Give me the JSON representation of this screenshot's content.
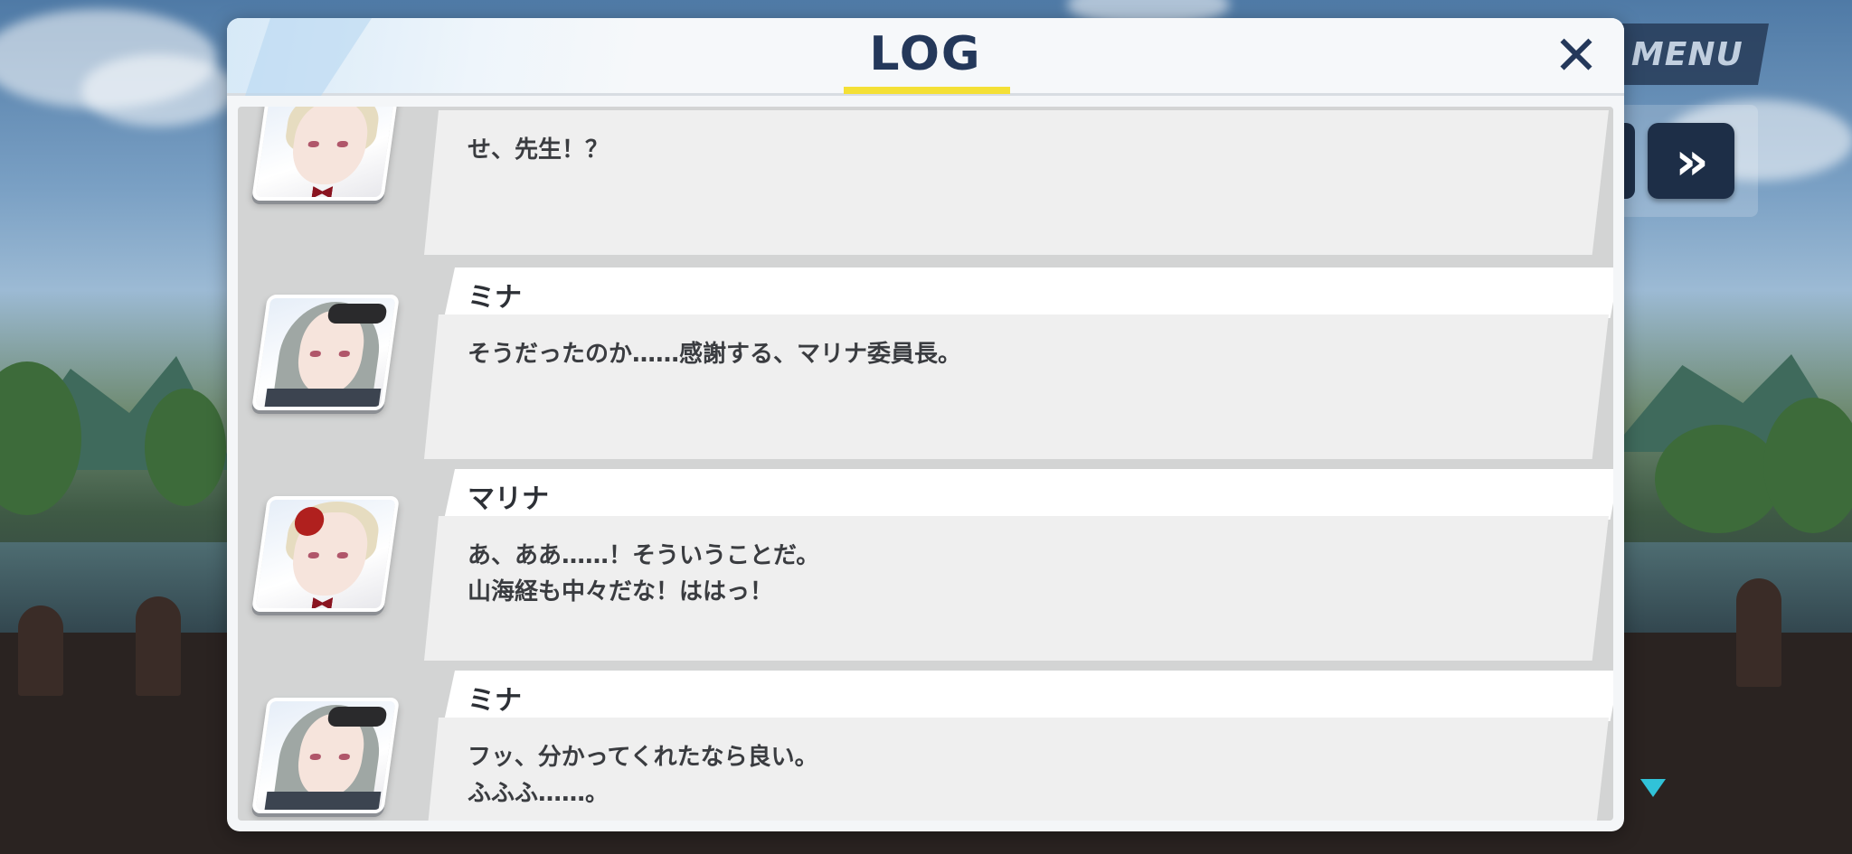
{
  "menu": {
    "label": "MENU",
    "fast_forward_icon": "fast-forward-icon"
  },
  "log": {
    "title": "LOG",
    "close_icon": "close-icon",
    "accent_color": "#f4e036",
    "entries": [
      {
        "name": "",
        "lines": [
          "せ、先生！？"
        ],
        "avatar": "marina-avatar"
      },
      {
        "name": "ミナ",
        "lines": [
          "そうだったのか……感謝する、マリナ委員長。"
        ],
        "avatar": "mina-avatar"
      },
      {
        "name": "マリナ",
        "lines": [
          "あ、ああ……！そういうことだ。",
          "山海経も中々だな！ははっ！"
        ],
        "avatar": "marina-avatar"
      },
      {
        "name": "ミナ",
        "lines": [
          "フッ、分かってくれたなら良い。",
          "ふふふ……。"
        ],
        "avatar": "mina-avatar"
      }
    ]
  }
}
